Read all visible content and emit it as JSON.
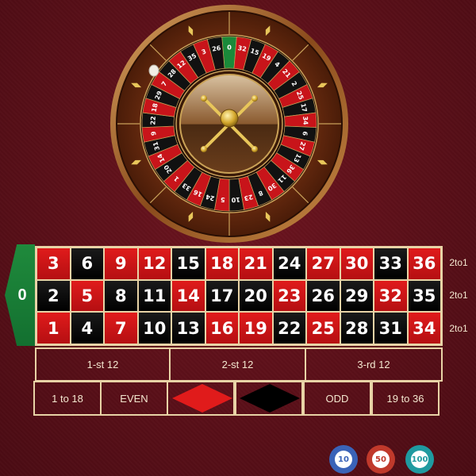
{
  "wheel": {
    "sequence": [
      "0",
      "32",
      "15",
      "19",
      "4",
      "21",
      "2",
      "25",
      "17",
      "34",
      "6",
      "27",
      "13",
      "36",
      "11",
      "30",
      "8",
      "23",
      "10",
      "5",
      "24",
      "16",
      "33",
      "1",
      "20",
      "14",
      "31",
      "9",
      "22",
      "18",
      "29",
      "7",
      "28",
      "12",
      "35",
      "3",
      "26"
    ],
    "reds": [
      1,
      3,
      5,
      7,
      9,
      12,
      14,
      16,
      18,
      19,
      21,
      23,
      25,
      27,
      30,
      32,
      34,
      36
    ]
  },
  "board": {
    "zero": "0",
    "rows": [
      [
        3,
        6,
        9,
        12,
        15,
        18,
        21,
        24,
        27,
        30,
        33,
        36
      ],
      [
        2,
        5,
        8,
        11,
        14,
        17,
        20,
        23,
        26,
        29,
        32,
        35
      ],
      [
        1,
        4,
        7,
        10,
        13,
        16,
        19,
        22,
        25,
        28,
        31,
        34
      ]
    ],
    "column_bets": [
      "2to1",
      "2to1",
      "2to1"
    ],
    "dozens": [
      "1-st 12",
      "2-st 12",
      "3-rd 12"
    ],
    "outside": {
      "low": "1 to 18",
      "even": "EVEN",
      "red_color": "#e01b1b",
      "black_color": "#000000",
      "odd": "ODD",
      "high": "19 to 36"
    }
  },
  "chips": [
    {
      "value": "10",
      "color": "#3a63b8"
    },
    {
      "value": "50",
      "color": "#c0392b"
    },
    {
      "value": "100",
      "color": "#1f9aa0"
    }
  ]
}
